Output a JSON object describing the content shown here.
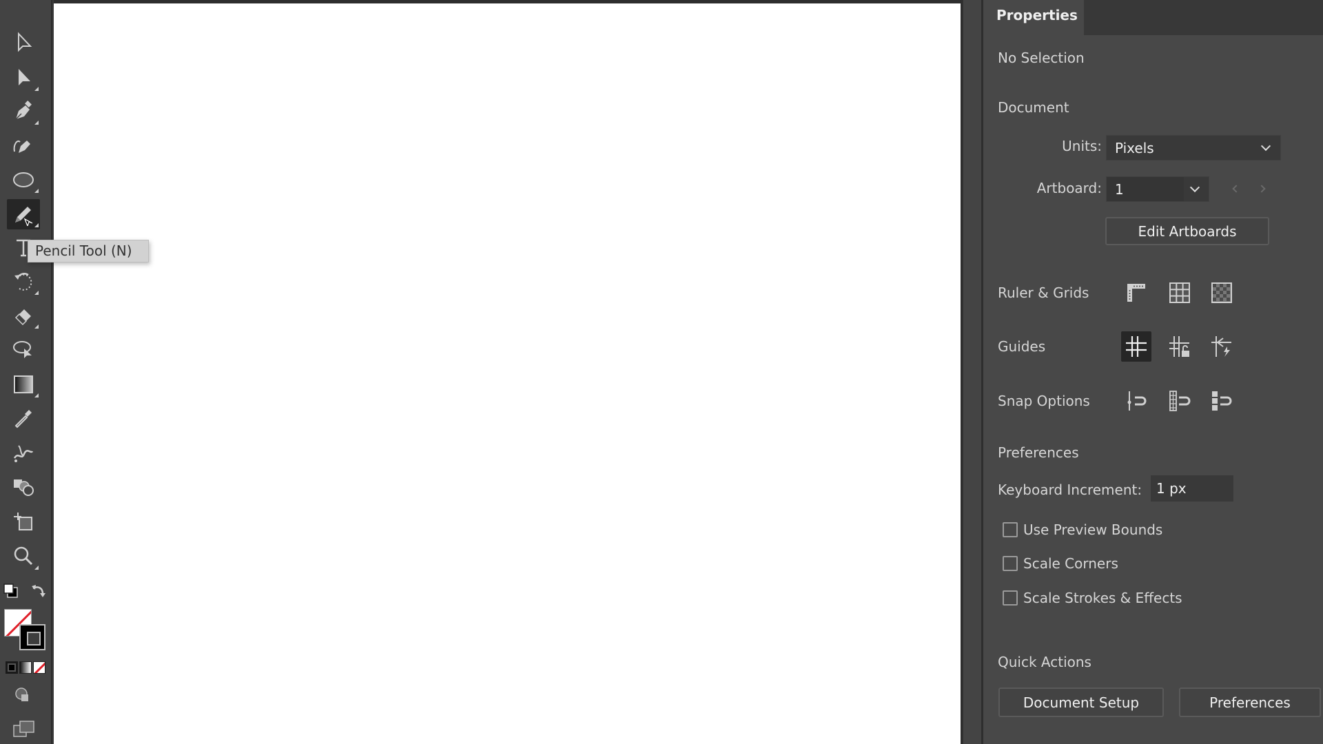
{
  "toolbar": {
    "tools": [
      {
        "name": "selection-tool",
        "icon": "selection-arrow-icon",
        "selected": false
      },
      {
        "name": "direct-selection-tool",
        "icon": "direct-selection-arrow-icon",
        "selected": false
      },
      {
        "name": "pen-tool",
        "icon": "pen-icon",
        "selected": false
      },
      {
        "name": "curvature-tool",
        "icon": "curvature-pen-icon",
        "selected": false
      },
      {
        "name": "ellipse-tool",
        "icon": "ellipse-icon",
        "selected": false
      },
      {
        "name": "pencil-tool",
        "icon": "pencil-icon",
        "selected": true
      },
      {
        "name": "type-tool",
        "icon": "type-icon",
        "selected": false
      },
      {
        "name": "rotate-tool",
        "icon": "rotate-icon",
        "selected": false
      },
      {
        "name": "eraser-tool",
        "icon": "eraser-icon",
        "selected": false
      },
      {
        "name": "lasso-tool",
        "icon": "lasso-icon",
        "selected": false
      },
      {
        "name": "gradient-tool",
        "icon": "gradient-icon",
        "selected": false
      },
      {
        "name": "eyedropper-tool",
        "icon": "eyedropper-icon",
        "selected": false
      },
      {
        "name": "puppet-warp-tool",
        "icon": "puppet-warp-icon",
        "selected": false
      },
      {
        "name": "shape-builder-tool",
        "icon": "shape-builder-icon",
        "selected": false
      },
      {
        "name": "artboard-tool",
        "icon": "artboard-icon",
        "selected": false
      },
      {
        "name": "zoom-tool",
        "icon": "magnifier-icon",
        "selected": false
      }
    ],
    "fill_color": "#ffffff",
    "stroke_color": "#000000",
    "none_indicator_color": "#e0202a"
  },
  "tooltip": {
    "text": "Pencil Tool (N)"
  },
  "panel": {
    "tab_label": "Properties",
    "selection_status": "No Selection",
    "document": {
      "heading": "Document",
      "units_label": "Units:",
      "units_value": "Pixels",
      "artboard_label": "Artboard:",
      "artboard_value": "1",
      "edit_artboards_label": "Edit Artboards"
    },
    "ruler_grids": {
      "label": "Ruler & Grids",
      "icons": [
        "ruler-icon",
        "grid-icon",
        "transparency-grid-icon"
      ]
    },
    "guides": {
      "label": "Guides",
      "icons": [
        "guides-icon",
        "lock-guides-icon",
        "smart-guides-icon"
      ],
      "active_index": 0
    },
    "snap_options": {
      "label": "Snap Options",
      "icons": [
        "snap-to-point-icon",
        "snap-to-pixel-icon",
        "snap-to-grid-icon"
      ]
    },
    "preferences": {
      "heading": "Preferences",
      "keyboard_increment_label": "Keyboard Increment:",
      "keyboard_increment_value": "1 px",
      "checkboxes": [
        {
          "label": "Use Preview Bounds",
          "checked": false
        },
        {
          "label": "Scale Corners",
          "checked": false
        },
        {
          "label": "Scale Strokes & Effects",
          "checked": false
        }
      ]
    },
    "quick_actions": {
      "heading": "Quick Actions",
      "document_setup_label": "Document Setup",
      "preferences_label": "Preferences"
    }
  }
}
